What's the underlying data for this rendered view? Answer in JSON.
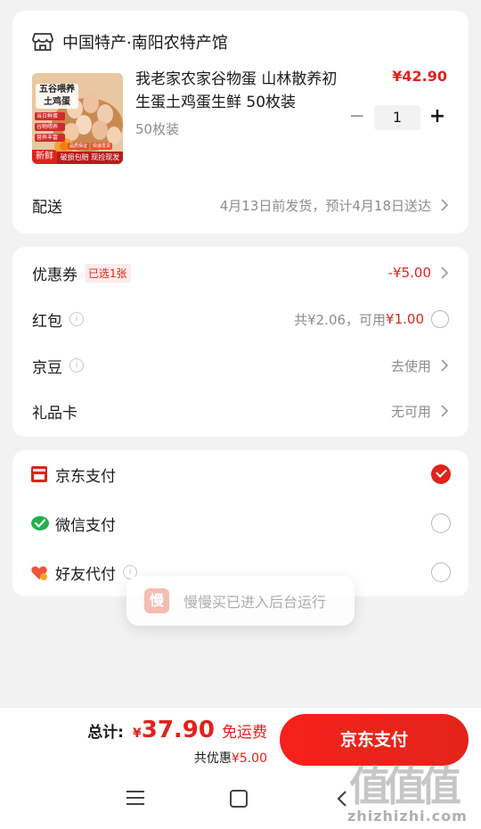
{
  "store": {
    "name": "中国特产·南阳农特产馆",
    "product": {
      "title": "我老家农家谷物蛋 山林散养初生蛋土鸡蛋生鲜 50枚装",
      "spec": "50枚装",
      "price": "¥42.90",
      "quantity": "1",
      "image": {
        "top_label": "五谷喂养土鸡蛋",
        "side_tags": [
          "当日鲜蛋",
          "谷物喂养",
          "营养丰富"
        ],
        "badges": [
          "品质保证",
          "快速发货"
        ],
        "fresh_label": "新鲜",
        "bottom_label": "破损包赔 现捡现发"
      }
    },
    "delivery": {
      "label": "配送",
      "value": "4月13日前发货，预计4月18日送达"
    }
  },
  "discounts": {
    "coupon": {
      "label": "优惠券",
      "tag": "已选1张",
      "value": "-¥5.00"
    },
    "redpack": {
      "label": "红包",
      "prefix": "共¥2.06，可用",
      "available": "¥1.00"
    },
    "jingdou": {
      "label": "京豆",
      "value": "去使用"
    },
    "giftcard": {
      "label": "礼品卡",
      "value": "无可用"
    }
  },
  "payment": {
    "methods": [
      {
        "label": "京东支付",
        "selected": true,
        "icon": "jd-pay-icon"
      },
      {
        "label": "微信支付",
        "selected": false,
        "icon": "wechat-pay-icon"
      },
      {
        "label": "好友代付",
        "selected": false,
        "icon": "friend-pay-icon"
      }
    ]
  },
  "toast": {
    "text": "慢慢买已进入后台运行",
    "logo": "慢"
  },
  "footer": {
    "total_label": "总计:",
    "currency": "¥",
    "total": "37.90",
    "free_shipping": "免运费",
    "saved_prefix": "共优惠",
    "saved_amount": "¥5.00",
    "pay_button": "京东支付"
  },
  "watermark": {
    "big": "值值值",
    "small": "zhizhizhi.com"
  },
  "colors": {
    "accent": "#e0221b",
    "background": "#f2f2f2"
  }
}
